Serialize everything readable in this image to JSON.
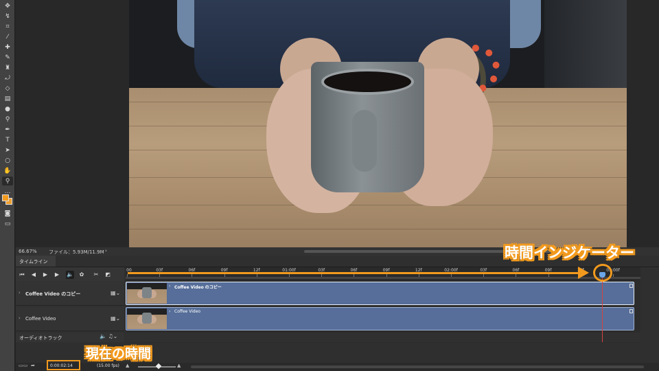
{
  "tools": [
    "move-icon",
    "marquee-icon",
    "lasso-icon",
    "quick-select-icon",
    "crop-icon",
    "eyedropper-icon",
    "healing-icon",
    "brush-icon",
    "stamp-icon",
    "history-brush-icon",
    "eraser-icon",
    "gradient-icon",
    "blur-icon",
    "dodge-icon",
    "pen-icon",
    "type-icon",
    "path-select-icon",
    "shape-icon",
    "hand-icon",
    "zoom-icon",
    "more-icon"
  ],
  "colors": {
    "foreground": "#f29a1e",
    "annotation": "#f29a1e",
    "clip": "#566e99",
    "playhead": "#d64242"
  },
  "status": {
    "zoom": "66.67%",
    "file_info": "ファイル：5.93M/11.9M"
  },
  "timeline": {
    "tab_label": "タイムライン",
    "ruler_labels": [
      "00",
      "03f",
      "06f",
      "09f",
      "12f",
      "01:00f",
      "03f",
      "06f",
      "09f",
      "12f",
      "02:00f",
      "03f",
      "06f",
      "09f",
      "12f",
      "03:00f"
    ],
    "tracks": [
      {
        "name": "Coffee Video のコピー",
        "clip_label": "Coffee Video のコピー"
      },
      {
        "name": "Coffee Video",
        "clip_label": "Coffee Video"
      }
    ],
    "audio_track": "オーディオトラック",
    "current_time": "0:00:02:14",
    "fps": "(15.00 fps)"
  },
  "annotations": {
    "indicator_label": "時間インジケーター",
    "current_time_label": "現在の時間"
  }
}
